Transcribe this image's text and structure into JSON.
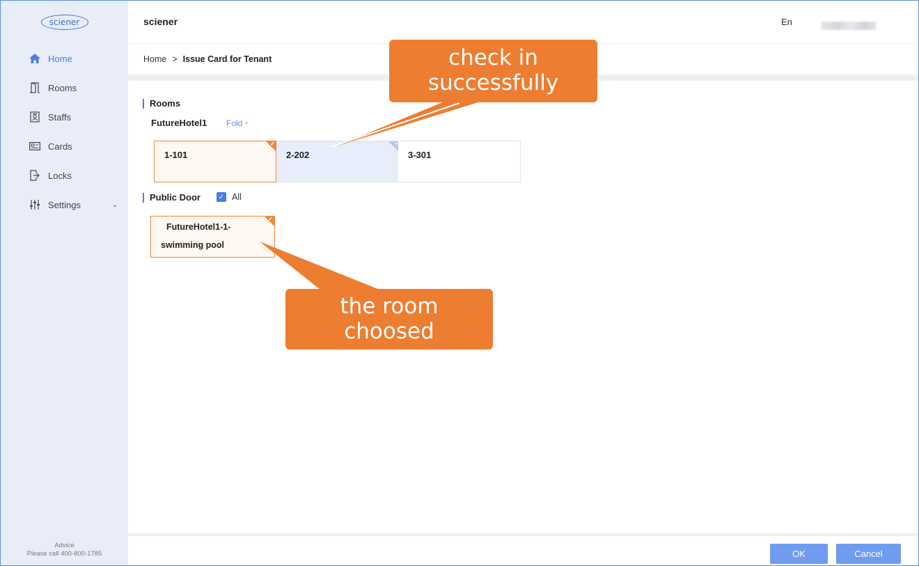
{
  "app": {
    "logo_text": "sciener",
    "title": "sciener",
    "language": "En"
  },
  "sidebar": {
    "items": [
      {
        "label": "Home",
        "icon": "home-icon",
        "active": true
      },
      {
        "label": "Rooms",
        "icon": "door-icon"
      },
      {
        "label": "Staffs",
        "icon": "staff-icon"
      },
      {
        "label": "Cards",
        "icon": "card-icon"
      },
      {
        "label": "Locks",
        "icon": "lock-icon"
      },
      {
        "label": "Settings",
        "icon": "settings-sliders-icon",
        "expandable": true
      }
    ],
    "advice_title": "Advice",
    "advice_text": "Please call 400-800-1785"
  },
  "breadcrumb": {
    "home": "Home",
    "separator": ">",
    "current": "Issue Card for Tenant"
  },
  "rooms_section": {
    "title": "Rooms",
    "hotel": "FutureHotel1",
    "fold_label": "Fold",
    "rooms": [
      {
        "label": "1-101",
        "state": "selected"
      },
      {
        "label": "2-202",
        "state": "checked-in"
      },
      {
        "label": "3-301",
        "state": "available"
      }
    ]
  },
  "public_door_section": {
    "title": "Public Door",
    "all_label": "All",
    "all_checked": true,
    "doors": [
      {
        "line1": "FutureHotel1-1-",
        "line2": "swimming pool",
        "state": "selected"
      }
    ]
  },
  "footer": {
    "ok_label": "OK",
    "cancel_label": "Cancel"
  },
  "annotations": {
    "callout_checkin_line1": "check in",
    "callout_checkin_line2": "successfully",
    "callout_room_line1": "the room",
    "callout_room_line2": "choosed"
  },
  "colors": {
    "accent": "#4a7ee0",
    "selected_border": "#f0883a",
    "callout": "#ed7d31",
    "sidebar_bg": "#e9edf8",
    "button": "#6f9bf0"
  }
}
